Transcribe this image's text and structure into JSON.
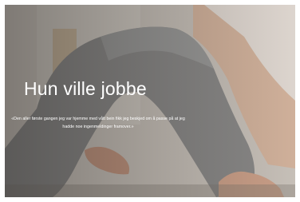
{
  "article": {
    "headline": "Hun ville jobbe",
    "quote": "«Den aller første gangen jeg var hjemme med vått bein fikk jeg beskjed om å passe på at jeg hadde noe ingenmeldinger framover.»"
  },
  "hero_image": {
    "depicts": "person stretching leg, grey sweatpants"
  }
}
